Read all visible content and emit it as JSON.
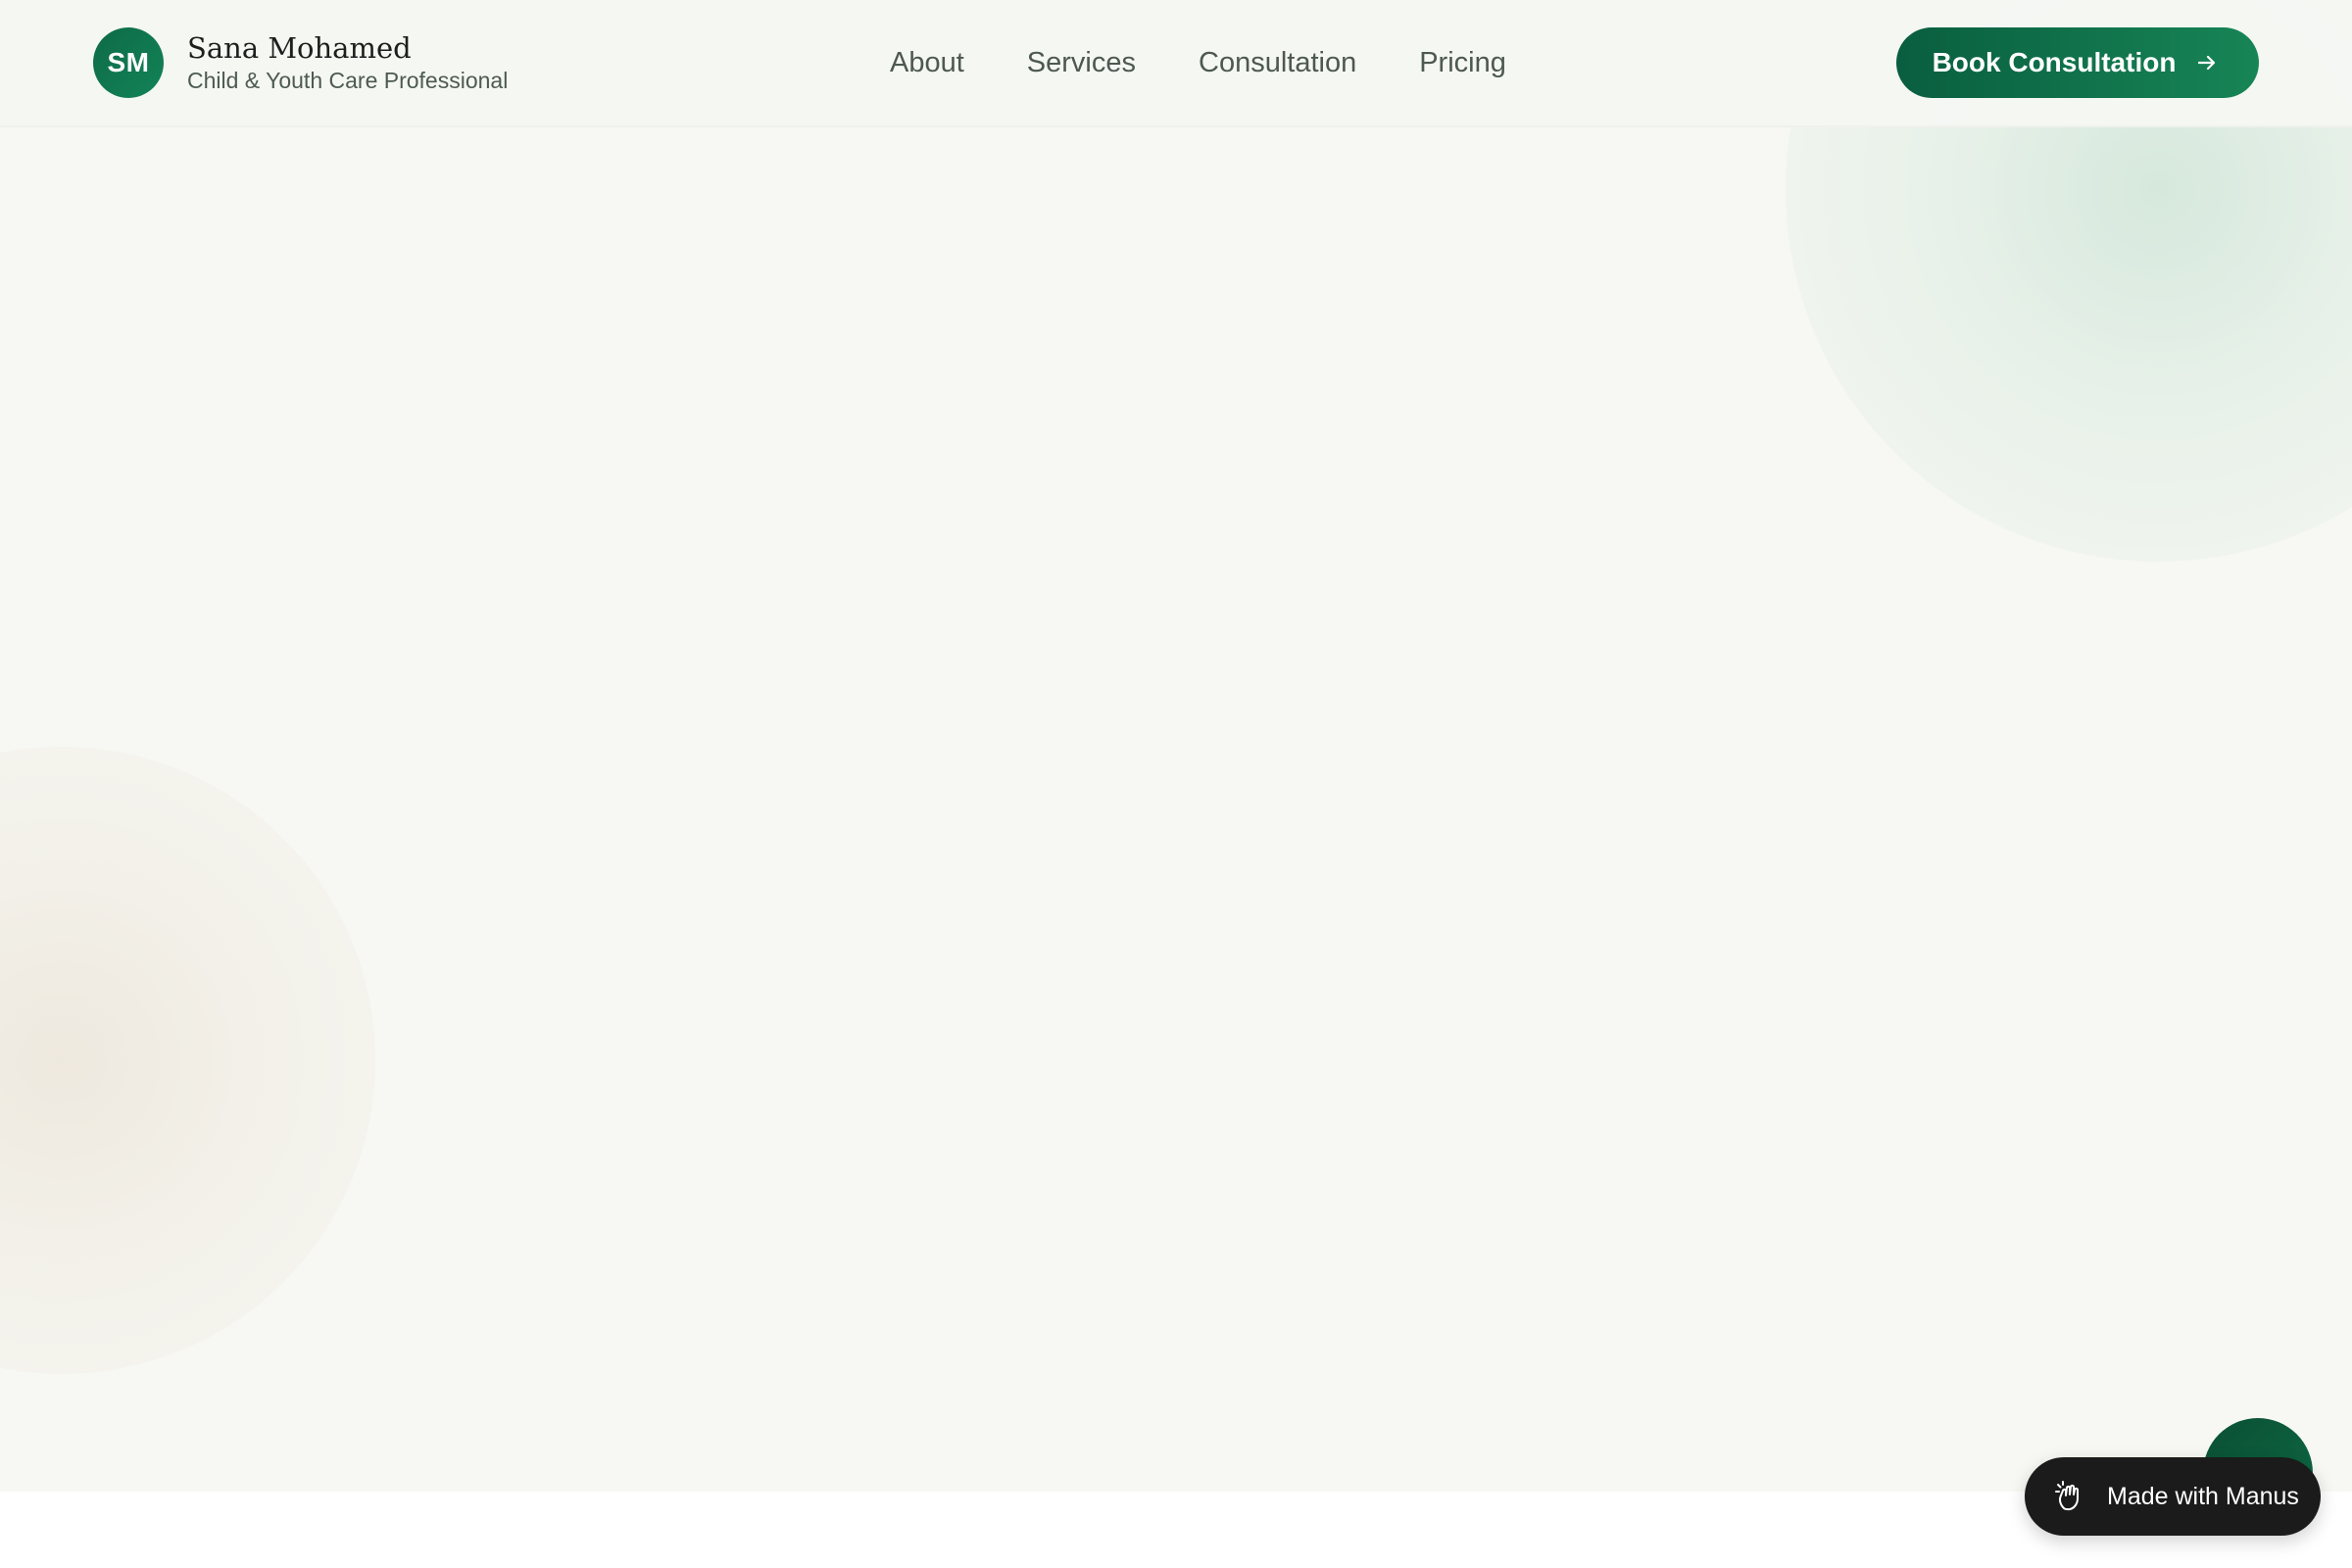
{
  "brand": {
    "initials": "SM",
    "name": "Sana Mohamed",
    "subtitle": "Child & Youth Care Professional"
  },
  "nav": {
    "items": [
      {
        "label": "About"
      },
      {
        "label": "Services"
      },
      {
        "label": "Consultation"
      },
      {
        "label": "Pricing"
      }
    ]
  },
  "cta": {
    "label": "Book Consultation",
    "icon": "arrow-right-icon"
  },
  "badge": {
    "label": "Made with Manus",
    "icon": "manus-hand-icon"
  },
  "colors": {
    "brand_green": "#0d6b47",
    "background": "#f7f8f3",
    "nav_text": "#4d5851",
    "badge_bg": "#1b1b1b"
  }
}
